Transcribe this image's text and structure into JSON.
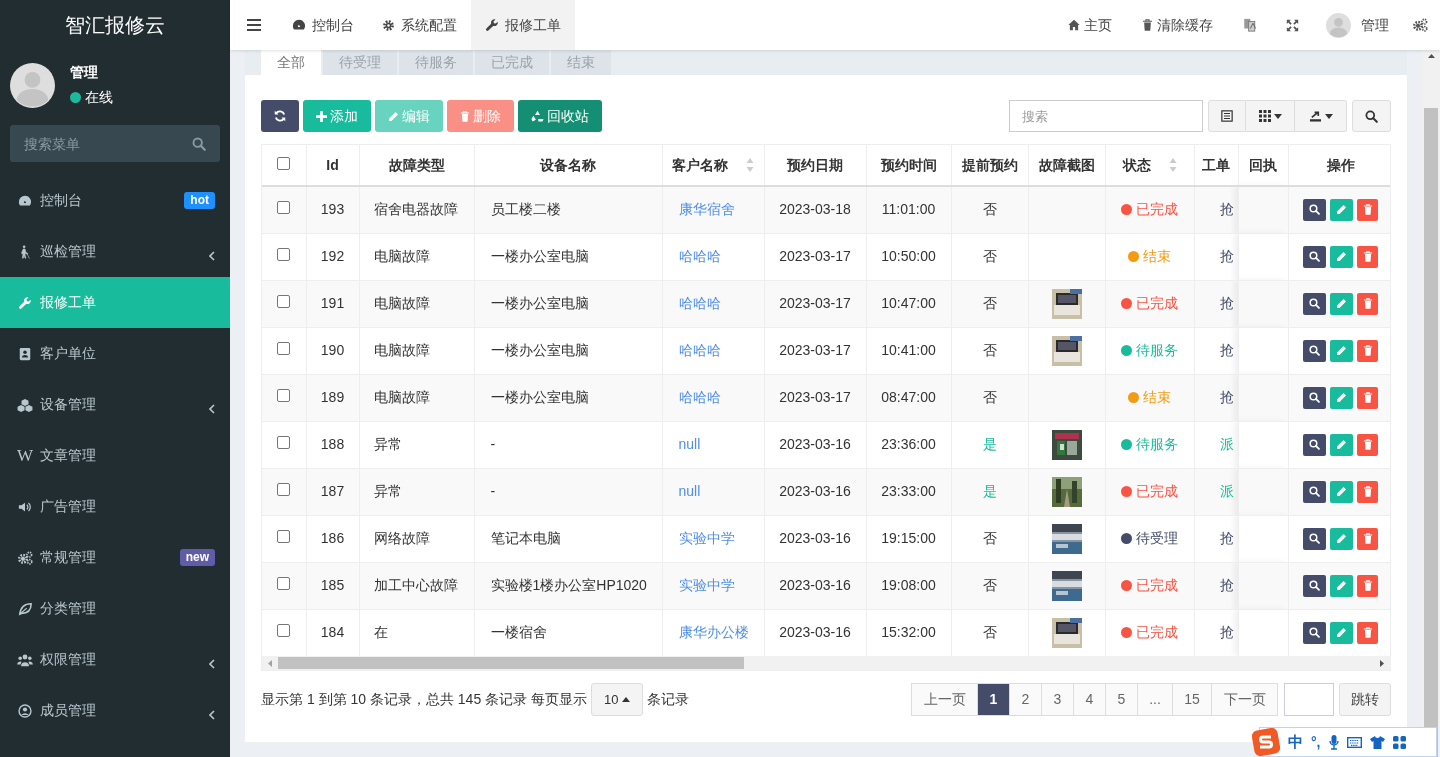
{
  "sidebar": {
    "logo": "智汇报修云",
    "user": {
      "name": "管理",
      "status": "在线"
    },
    "search": {
      "placeholder": "搜索菜单"
    },
    "items": [
      {
        "label": "控制台",
        "selected": false,
        "badge": {
          "text": "hot",
          "color": "#1e90ff"
        }
      },
      {
        "label": "巡检管理",
        "selected": false,
        "has_children": true
      },
      {
        "label": "报修工单",
        "selected": true
      },
      {
        "label": "客户单位",
        "selected": false
      },
      {
        "label": "设备管理",
        "selected": false,
        "has_children": true
      },
      {
        "label": "文章管理",
        "selected": false,
        "glyph": "W"
      },
      {
        "label": "广告管理",
        "selected": false
      },
      {
        "label": "常规管理",
        "selected": false,
        "badge": {
          "text": "new",
          "color": "#605ca8"
        }
      },
      {
        "label": "分类管理",
        "selected": false
      },
      {
        "label": "权限管理",
        "selected": false,
        "has_children": true
      },
      {
        "label": "成员管理",
        "selected": false,
        "has_children": true
      }
    ]
  },
  "topbar": {
    "nav": [
      {
        "label": "控制台",
        "selected": false
      },
      {
        "label": "系统配置",
        "selected": false
      },
      {
        "label": "报修工单",
        "selected": true
      }
    ],
    "right": [
      {
        "label": "主页"
      },
      {
        "label": "清除缓存"
      }
    ],
    "user": "管理"
  },
  "tabs": [
    {
      "label": "全部",
      "selected": true
    },
    {
      "label": "待受理",
      "selected": false
    },
    {
      "label": "待服务",
      "selected": false
    },
    {
      "label": "已完成",
      "selected": false
    },
    {
      "label": "结束",
      "selected": false
    }
  ],
  "toolbar": {
    "buttons": [
      {
        "kind": "refresh",
        "disabled": false
      },
      {
        "kind": "add",
        "label": "添加",
        "disabled": false
      },
      {
        "kind": "edit",
        "label": "编辑",
        "disabled": true
      },
      {
        "kind": "delete",
        "label": "删除",
        "disabled": true
      },
      {
        "kind": "recycle",
        "label": "回收站",
        "disabled": false
      }
    ],
    "search": {
      "placeholder": "搜索"
    }
  },
  "table": {
    "header_checked": false,
    "columns": [
      {
        "label": "Id"
      },
      {
        "label": "故障类型"
      },
      {
        "label": "设备名称"
      },
      {
        "label": "客户名称",
        "sortable": true
      },
      {
        "label": "预约日期"
      },
      {
        "label": "预约时间"
      },
      {
        "label": "提前预约"
      },
      {
        "label": "故障截图"
      },
      {
        "label": "状态",
        "sortable": true
      },
      {
        "label": "工单"
      },
      {
        "label": "回执"
      },
      {
        "label": "操作"
      }
    ],
    "rows": [
      {
        "checked": false,
        "id": "193",
        "fault": "宿舍电器故障",
        "device": "员工楼二楼",
        "customer": "康华宿舍",
        "date": "2023-03-18",
        "time": "11:01:00",
        "advance": {
          "text": "否",
          "highlight": false
        },
        "status": {
          "text": "已完成",
          "color": "#f75444"
        },
        "order_type": {
          "text": "抢",
          "highlight": false
        }
      },
      {
        "checked": false,
        "id": "192",
        "fault": "电脑故障",
        "device": "一楼办公室电脑",
        "customer": "哈哈哈",
        "date": "2023-03-17",
        "time": "10:50:00",
        "advance": {
          "text": "否",
          "highlight": false
        },
        "status": {
          "text": "结束",
          "color": "#f39c12"
        },
        "order_type": {
          "text": "抢",
          "highlight": false
        }
      },
      {
        "checked": false,
        "id": "191",
        "fault": "电脑故障",
        "device": "一楼办公室电脑",
        "customer": "哈哈哈",
        "date": "2023-03-17",
        "time": "10:47:00",
        "advance": {
          "text": "否",
          "highlight": false
        },
        "status": {
          "text": "已完成",
          "color": "#f75444"
        },
        "order_type": {
          "text": "抢",
          "highlight": false
        }
      },
      {
        "checked": false,
        "id": "190",
        "fault": "电脑故障",
        "device": "一楼办公室电脑",
        "customer": "哈哈哈",
        "date": "2023-03-17",
        "time": "10:41:00",
        "advance": {
          "text": "否",
          "highlight": false
        },
        "status": {
          "text": "待服务",
          "color": "#18bc9c"
        },
        "order_type": {
          "text": "抢",
          "highlight": false
        }
      },
      {
        "checked": false,
        "id": "189",
        "fault": "电脑故障",
        "device": "一楼办公室电脑",
        "customer": "哈哈哈",
        "date": "2023-03-17",
        "time": "08:47:00",
        "advance": {
          "text": "否",
          "highlight": false
        },
        "status": {
          "text": "结束",
          "color": "#f39c12"
        },
        "order_type": {
          "text": "抢",
          "highlight": false
        }
      },
      {
        "checked": false,
        "id": "188",
        "fault": "异常",
        "device": "-",
        "customer": "null",
        "date": "2023-03-16",
        "time": "23:36:00",
        "advance": {
          "text": "是",
          "highlight": true
        },
        "status": {
          "text": "待服务",
          "color": "#18bc9c"
        },
        "order_type": {
          "text": "派",
          "highlight": true
        }
      },
      {
        "checked": false,
        "id": "187",
        "fault": "异常",
        "device": "-",
        "customer": "null",
        "date": "2023-03-16",
        "time": "23:33:00",
        "advance": {
          "text": "是",
          "highlight": true
        },
        "status": {
          "text": "已完成",
          "color": "#f75444"
        },
        "order_type": {
          "text": "派",
          "highlight": true
        }
      },
      {
        "checked": false,
        "id": "186",
        "fault": "网络故障",
        "device": "笔记本电脑",
        "customer": "实验中学",
        "date": "2023-03-16",
        "time": "19:15:00",
        "advance": {
          "text": "否",
          "highlight": false
        },
        "status": {
          "text": "待受理",
          "color": "#444c69"
        },
        "order_type": {
          "text": "抢",
          "highlight": false
        }
      },
      {
        "checked": false,
        "id": "185",
        "fault": "加工中心故障",
        "device": "实验楼1楼办公室HP1020",
        "customer": "实验中学",
        "date": "2023-03-16",
        "time": "19:08:00",
        "advance": {
          "text": "否",
          "highlight": false
        },
        "status": {
          "text": "已完成",
          "color": "#f75444"
        },
        "order_type": {
          "text": "抢",
          "highlight": false
        }
      },
      {
        "checked": false,
        "id": "184",
        "fault": "在",
        "device": "一楼宿舍",
        "customer": "康华办公楼",
        "date": "2023-03-16",
        "time": "15:32:00",
        "advance": {
          "text": "否",
          "highlight": false
        },
        "status": {
          "text": "已完成",
          "color": "#f75444"
        },
        "order_type": {
          "text": "抢",
          "highlight": false
        }
      }
    ]
  },
  "footer": {
    "summary": "显示第 1 到第 10 条记录，总共 145 条记录 每页显示",
    "page_size": "10",
    "suffix": "条记录",
    "pages": [
      {
        "label": "上一页",
        "selected": false
      },
      {
        "label": "1",
        "selected": true
      },
      {
        "label": "2",
        "selected": false
      },
      {
        "label": "3",
        "selected": false
      },
      {
        "label": "4",
        "selected": false
      },
      {
        "label": "5",
        "selected": false
      },
      {
        "label": "...",
        "selected": false
      },
      {
        "label": "15",
        "selected": false
      },
      {
        "label": "下一页",
        "selected": false
      }
    ],
    "jump": "跳转"
  },
  "ime": {
    "mode": "中",
    "punct": "°,"
  }
}
